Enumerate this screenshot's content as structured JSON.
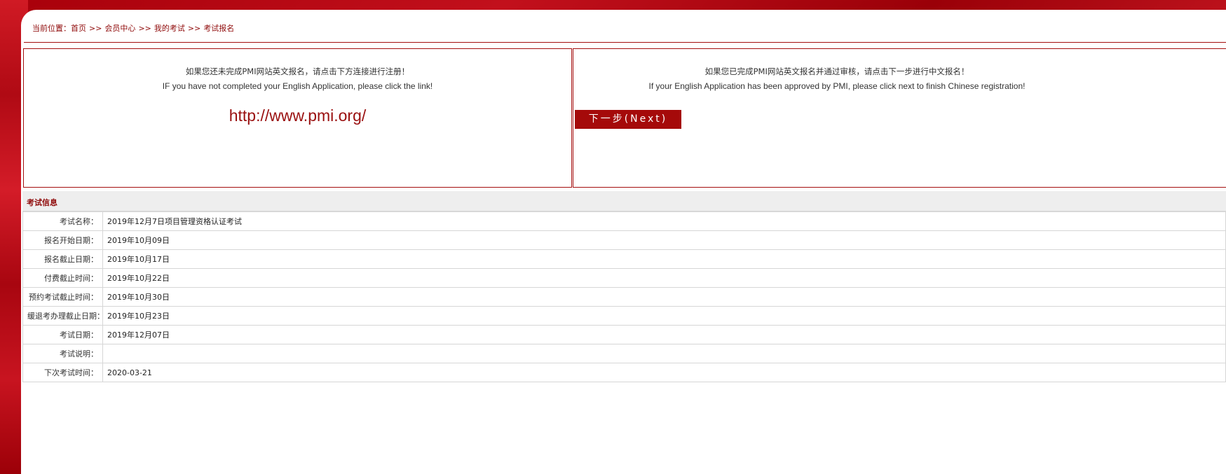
{
  "breadcrumb": {
    "prefix": "当前位置：",
    "items": [
      "首页",
      "会员中心",
      "我的考试",
      "考试报名"
    ],
    "separator": ">>"
  },
  "left_box": {
    "line1": "如果您还未完成PMI网站英文报名，请点击下方连接进行注册！",
    "line2": "IF you have not completed your English Application, please click the link!",
    "link": "http://www.pmi.org/"
  },
  "right_box": {
    "line1": "如果您已完成PMI网站英文报名并通过审核，请点击下一步进行中文报名！",
    "line2": "If your English Application has been approved by PMI, please click next to finish Chinese registration!",
    "button_label": "下一步(Next)"
  },
  "exam_info": {
    "title": "考试信息",
    "rows": [
      {
        "label": "考试名称：",
        "value": "2019年12月7日项目管理资格认证考试"
      },
      {
        "label": "报名开始日期：",
        "value": "2019年10月09日"
      },
      {
        "label": "报名截止日期：",
        "value": "2019年10月17日"
      },
      {
        "label": "付费截止时间：",
        "value": "2019年10月22日"
      },
      {
        "label": "预约考试截止时间：",
        "value": "2019年10月30日"
      },
      {
        "label": "缓退考办理截止日期：",
        "value": "2019年10月23日"
      },
      {
        "label": "考试日期：",
        "value": "2019年12月07日"
      },
      {
        "label": "考试说明：",
        "value": ""
      },
      {
        "label": "下次考试时间：",
        "value": "2020-03-21"
      }
    ]
  },
  "colors": {
    "brand_red": "#a50a0a",
    "text_red": "#8f0a0a",
    "header_gray": "#eeeeee"
  }
}
